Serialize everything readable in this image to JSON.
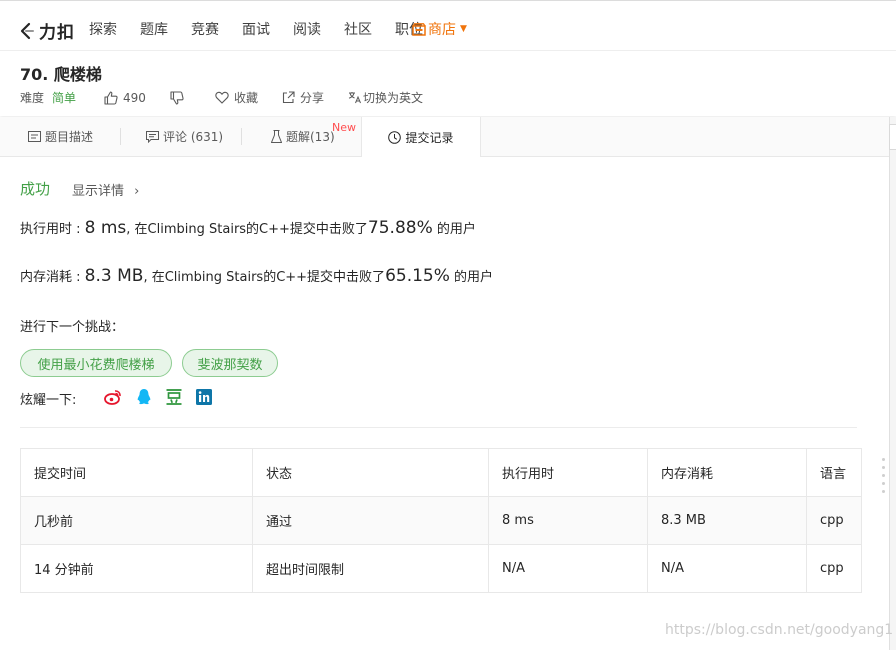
{
  "nav": {
    "brand": "力扣",
    "items": [
      "探索",
      "题库",
      "竞赛",
      "面试",
      "阅读",
      "社区",
      "职位"
    ],
    "store_label": "商店",
    "colors": {
      "store": "#f0740c"
    }
  },
  "problem": {
    "title": "70. 爬楼梯",
    "difficulty_label": "难度",
    "difficulty_value": "简单",
    "likes": "490",
    "favorite_label": "收藏",
    "share_label": "分享",
    "switch_lang_label": "切换为英文"
  },
  "tabs": [
    {
      "label": "题目描述",
      "icon": "description-icon"
    },
    {
      "label": "评论 (631)",
      "icon": "comment-icon"
    },
    {
      "label": "题解(13)",
      "icon": "flask-icon",
      "badge": "New"
    },
    {
      "label": "提交记录",
      "icon": "clock-icon",
      "active": true
    }
  ],
  "result": {
    "status": "成功",
    "detail_label": "显示详情",
    "runtime_label": "执行用时 : ",
    "runtime_value": "8 ms",
    "runtime_mid": ", 在Climbing Stairs的C++提交中击败了",
    "runtime_pct": "75.88%",
    "runtime_tail": " 的用户",
    "memory_label": "内存消耗 : ",
    "memory_value": "8.3 MB",
    "memory_mid": ", 在Climbing Stairs的C++提交中击败了",
    "memory_pct": "65.15%",
    "memory_tail": " 的用户",
    "colors": {
      "success": "#43a047"
    }
  },
  "challenge": {
    "title": "进行下一个挑战：",
    "items": [
      "使用最小花费爬楼梯",
      "斐波那契数"
    ]
  },
  "share": {
    "label": "炫耀一下:",
    "icons": [
      "weibo-icon",
      "qq-icon",
      "douban-icon",
      "linkedin-icon"
    ]
  },
  "table": {
    "headers": [
      "提交时间",
      "状态",
      "执行用时",
      "内存消耗",
      "语言"
    ],
    "rows": [
      [
        "几秒前",
        "通过",
        "8 ms",
        "8.3 MB",
        "cpp"
      ],
      [
        "14 分钟前",
        "超出时间限制",
        "N/A",
        "N/A",
        "cpp"
      ]
    ],
    "colors": {
      "pass": "#00897b",
      "fail": "#d32f2f"
    }
  },
  "watermark": "https://blog.csdn.net/goodyang1"
}
